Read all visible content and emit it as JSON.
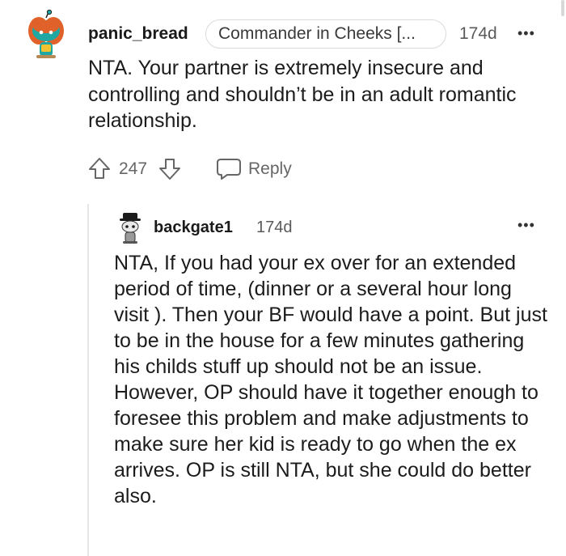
{
  "comment": {
    "username": "panic_bread",
    "flair": "Commander in Cheeks [...",
    "age": "174d",
    "more_label": "•••",
    "body": "NTA. Your partner is extremely insecure and controlling and shouldn’t be in an adult romantic relationship.",
    "score": "247",
    "reply_label": "Reply"
  },
  "reply": {
    "username": "backgate1",
    "age": "174d",
    "more_label": "•••",
    "body": "NTA, If you had your ex over for an extended period of time, (dinner or a several hour long visit ). Then your BF would have a point. But just to be in the house for a few minutes gathering his childs stuff up should not be an issue. However, OP should have it together enough to foresee this problem and make adjustments to make sure her kid is ready to go when the ex arrives. OP is still NTA, but she could do better also."
  },
  "icons": {
    "upvote": "arrow-up-icon",
    "downvote": "arrow-down-icon",
    "reply": "speech-bubble-icon",
    "more": "more-options-icon"
  },
  "colors": {
    "avatar_teal": "#1fa7a3",
    "avatar_orange": "#e0622a",
    "muted_text": "#5a5a5a",
    "thread_line": "#e6e6e6"
  }
}
